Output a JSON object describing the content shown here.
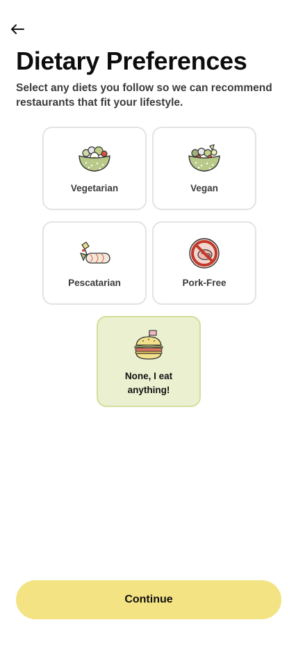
{
  "header": {
    "back_icon": "arrow-left-icon",
    "title": "Dietary Preferences",
    "subtitle": "Select any diets you follow so we can recommend restaurants that fit your lifestyle."
  },
  "options": [
    {
      "label": "Vegetarian",
      "icon": "salad-bowl-icon",
      "selected": false
    },
    {
      "label": "Vegan",
      "icon": "vegan-bowl-icon",
      "selected": false
    },
    {
      "label": "Pescatarian",
      "icon": "sushi-roll-icon",
      "selected": false
    },
    {
      "label": "Pork-Free",
      "icon": "no-pork-icon",
      "selected": false
    },
    {
      "label": "None, I eat anything!",
      "icon": "burger-icon",
      "selected": true
    }
  ],
  "continue_label": "Continue",
  "colors": {
    "accent": "#f3e382",
    "selected_bg": "#ebf0d0",
    "selected_border": "#d3df9d",
    "card_border": "#e3e3e3"
  }
}
